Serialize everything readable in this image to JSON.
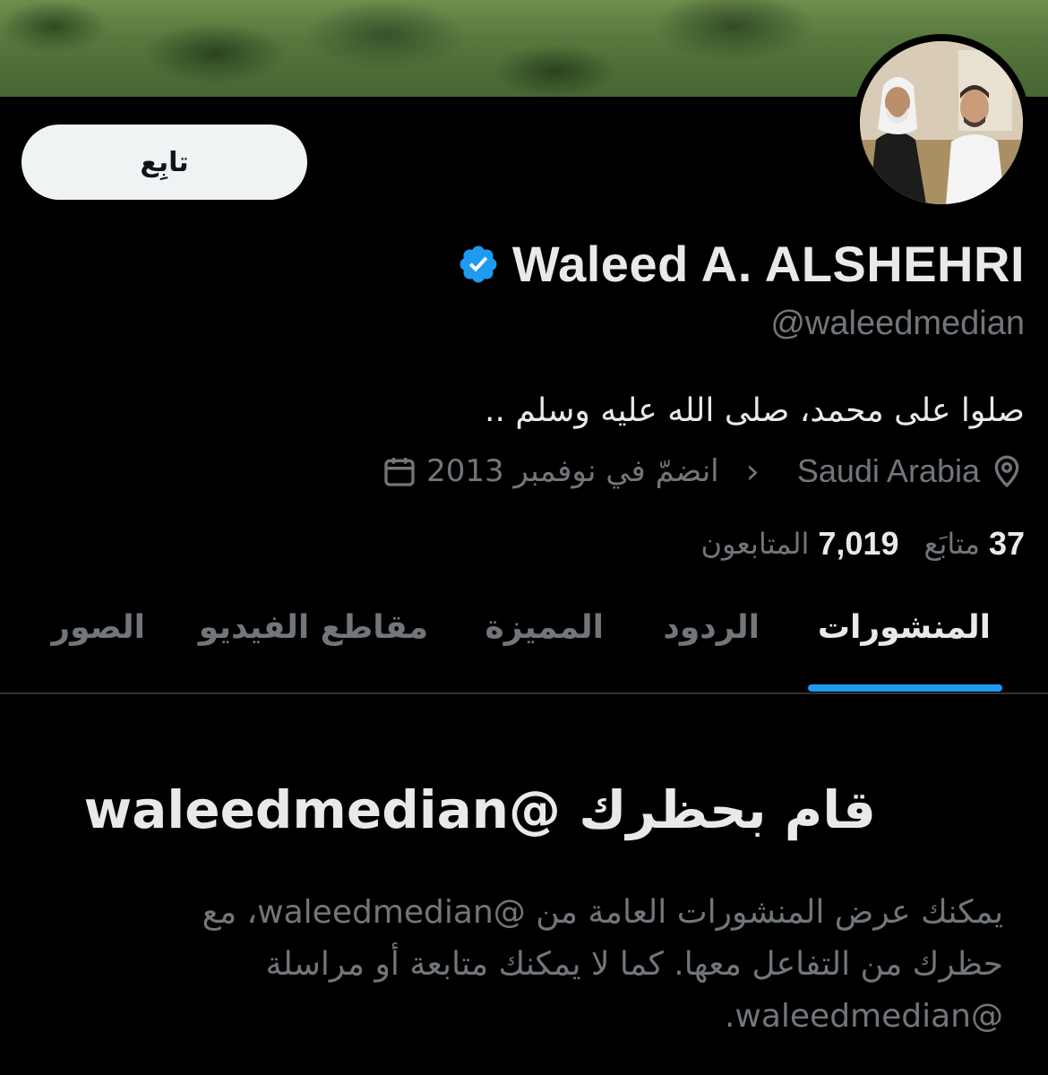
{
  "banner": {
    "icon": "landscape-banner-image"
  },
  "avatar": {
    "icon": "profile-photo-two-men"
  },
  "follow_button": {
    "label": "تابِع"
  },
  "profile": {
    "display_name": "Waleed A. ALSHEHRI",
    "verified_icon": "verified-badge-icon",
    "handle": "@waleedmedian",
    "bio": "صلوا على محمد، صلى الله عليه وسلم ..",
    "location": "Saudi Arabia",
    "location_icon": "location-pin-icon",
    "separator": "‹",
    "joined": "انضمّ في نوفمبر 2013",
    "joined_icon": "calendar-icon"
  },
  "stats": {
    "following_count": "37",
    "following_label": "متابَع",
    "followers_count": "7,019",
    "followers_label": "المتابعون"
  },
  "tabs": [
    {
      "label": "المنشورات",
      "active": true
    },
    {
      "label": "الردود",
      "active": false
    },
    {
      "label": "المميزة",
      "active": false
    },
    {
      "label": "مقاطع الفيديو",
      "active": false
    },
    {
      "label": "الصور",
      "active": false
    }
  ],
  "blocked": {
    "title": "قام بحظرك @waleedmedian",
    "body_lines": [
      "يمكنك عرض المنشورات العامة من @waleedmedian، مع",
      "حظرك من التفاعل معها. كما لا يمكنك متابعة أو مراسلة",
      "@waleedmedian."
    ]
  },
  "colors": {
    "background": "#000000",
    "accent": "#1d9bf0",
    "primary_text": "#e7e9ea",
    "secondary_text": "#71767b",
    "button_bg": "#eff3f4"
  }
}
